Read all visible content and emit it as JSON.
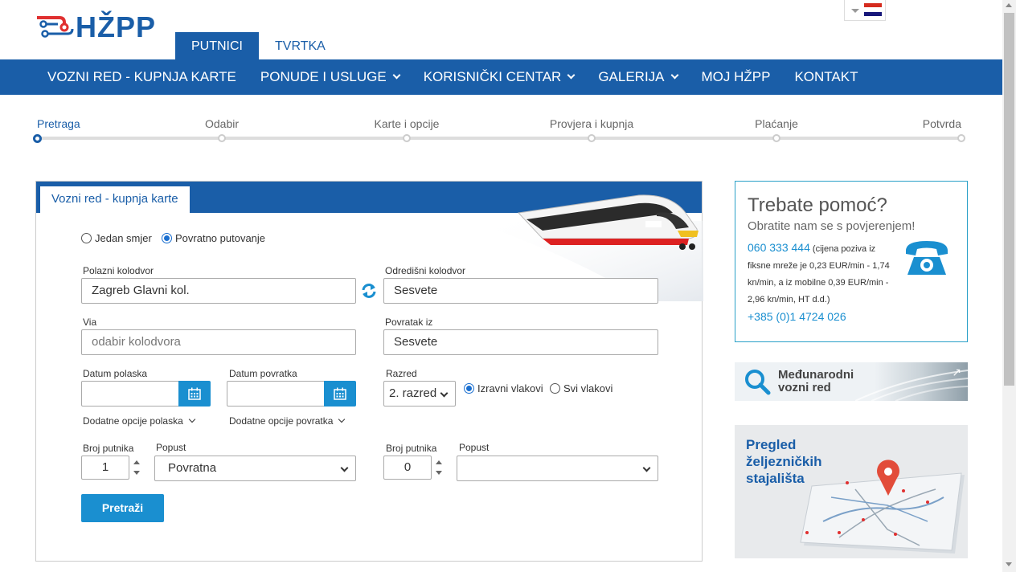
{
  "header": {
    "logo_text": "HŽPP",
    "top_tabs": [
      {
        "label": "PUTNICI",
        "active": true
      },
      {
        "label": "TVRTKA",
        "active": false
      }
    ],
    "language_flag": "croatian-flag-icon"
  },
  "nav": {
    "items": [
      {
        "label": "VOZNI RED - KUPNJA KARTE",
        "dropdown": false
      },
      {
        "label": "PONUDE I USLUGE",
        "dropdown": true
      },
      {
        "label": "KORISNIČKI CENTAR",
        "dropdown": true
      },
      {
        "label": "GALERIJA",
        "dropdown": true
      },
      {
        "label": "MOJ HŽPP",
        "dropdown": false
      },
      {
        "label": "KONTAKT",
        "dropdown": false
      }
    ]
  },
  "steps": {
    "items": [
      "Pretraga",
      "Odabir",
      "Karte i opcije",
      "Provjera i kupnja",
      "Plaćanje",
      "Potvrda"
    ],
    "active_index": 0
  },
  "search_panel": {
    "tab_label": "Vozni red - kupnja karte",
    "trip_type": {
      "one_way": "Jedan smjer",
      "return": "Povratno putovanje",
      "selected": "return"
    },
    "departure_station": {
      "label": "Polazni kolodvor",
      "value": "Zagreb Glavni kol."
    },
    "arrival_station": {
      "label": "Odredišni kolodvor",
      "value": "Sesvete"
    },
    "via": {
      "label": "Via",
      "placeholder": "odabir kolodvora"
    },
    "return_from": {
      "label": "Povratak iz",
      "value": "Sesvete"
    },
    "departure_date": {
      "label": "Datum polaska",
      "value": ""
    },
    "return_date": {
      "label": "Datum povratka",
      "value": ""
    },
    "class": {
      "label": "Razred",
      "value": "2. razred"
    },
    "train_filter": {
      "direct": "Izravni vlakovi",
      "all": "Svi vlakovi",
      "selected": "direct"
    },
    "more_departure_options": "Dodatne opcije polaska",
    "more_return_options": "Dodatne opcije povratka",
    "passengers_out": {
      "label": "Broj putnika",
      "value": "1"
    },
    "discount_out": {
      "label": "Popust",
      "value": "Povratna"
    },
    "passengers_return": {
      "label": "Broj putnika",
      "value": "0"
    },
    "discount_return": {
      "label": "Popust",
      "value": ""
    },
    "search_button": "Pretraži"
  },
  "help_box": {
    "title": "Trebate pomoć?",
    "subtitle": "Obratite nam se s povjerenjem!",
    "phone_primary": "060 333 444",
    "phone_primary_note": "(cijena poziva iz fiksne mreže je 0,23 EUR/min - 1,74 kn/min, a iz mobilne 0,39 EUR/min - 2,96 kn/min, HT d.d.)",
    "phone_secondary": "+385 (0)1 4724 026"
  },
  "international_banner": {
    "line1": "Međunarodni",
    "line2": "vozni red"
  },
  "map_banner": {
    "line1": "Pregled",
    "line2": "željezničkih",
    "line3": "stajališta"
  },
  "colors": {
    "brand_blue": "#1a5ea8",
    "accent_blue": "#1a8fd0",
    "logo_red": "#e03030"
  }
}
